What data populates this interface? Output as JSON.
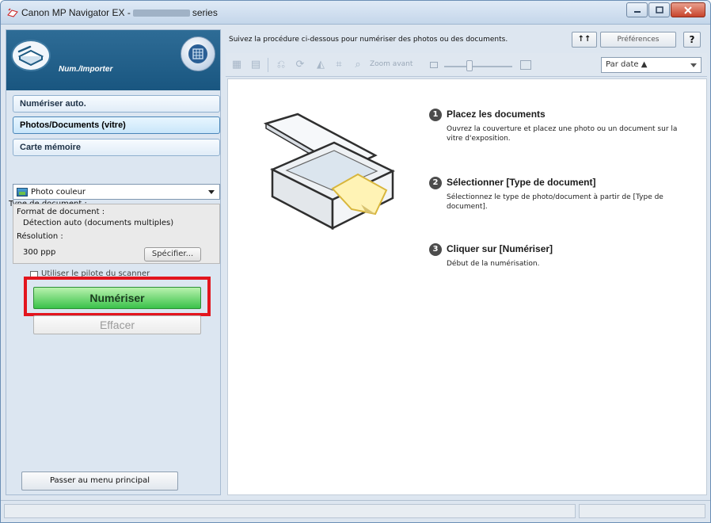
{
  "window": {
    "title_prefix": "Canon MP Navigator EX -",
    "title_suffix": "series"
  },
  "left": {
    "header_title": "Num./Importer",
    "nav": [
      {
        "label": "Numériser auto.",
        "selected": false
      },
      {
        "label": "Photos/Documents (vitre)",
        "selected": true
      },
      {
        "label": "Carte mémoire",
        "selected": false
      }
    ],
    "doc_type_label": "Type de document :",
    "doc_type_value": "Photo couleur",
    "format_label": "Format de document :",
    "format_value": "Détection auto (documents multiples)",
    "resolution_label": "Résolution :",
    "resolution_value": "300 ppp",
    "specify_button": "Spécifier...",
    "scanner_driver_checkbox": "Utiliser le pilote du scanner",
    "scan_button": "Numériser",
    "clear_button": "Effacer",
    "main_menu_button": "Passer au menu principal"
  },
  "right": {
    "instructions": "Suivez la procédure ci-dessous pour numériser des photos ou des documents.",
    "sort_toggle": "↑↑",
    "preferences_button": "Préférences",
    "help_button": "?",
    "zoom_label": "Zoom avant",
    "sort_value": "Par date ▲",
    "steps": [
      {
        "num": "1",
        "title": "Placez les documents",
        "desc": "Ouvrez la couverture et placez une photo ou un document sur la vitre d'exposition."
      },
      {
        "num": "2",
        "title": "Sélectionner [Type de document]",
        "desc": "Sélectionnez le type de photo/document à partir de [Type de document]."
      },
      {
        "num": "3",
        "title": "Cliquer sur [Numériser]",
        "desc": "Début de la numérisation."
      }
    ]
  },
  "colors": {
    "scan_button": "#3ac24a",
    "highlight_box": "#e3151e",
    "header_blue": "#195680"
  }
}
